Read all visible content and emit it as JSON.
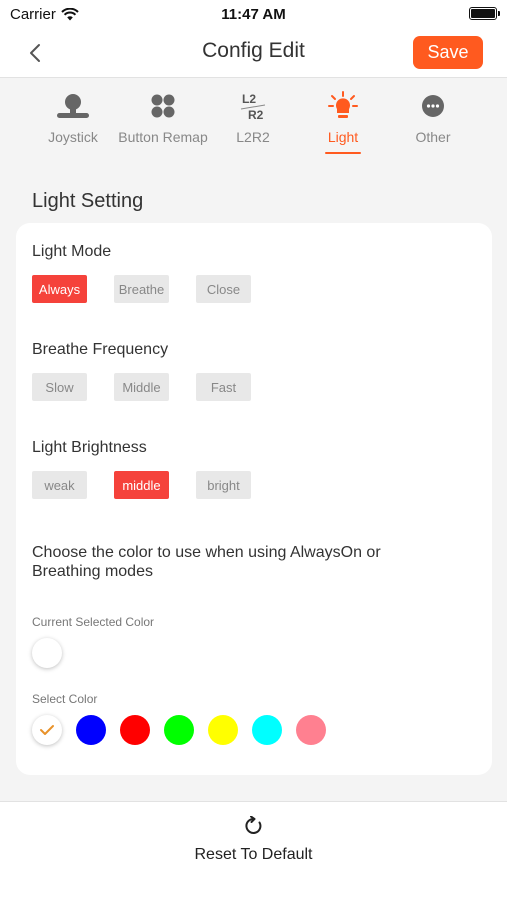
{
  "status_bar": {
    "carrier": "Carrier",
    "time": "11:47 AM",
    "wifi_icon": "wifi-icon",
    "battery_icon": "battery-icon"
  },
  "nav": {
    "title": "Config Edit",
    "save_label": "Save",
    "back_icon": "chevron-left-icon"
  },
  "tabs": [
    {
      "label": "Joystick",
      "icon": "joystick-icon",
      "active": false
    },
    {
      "label": "Button Remap",
      "icon": "button-remap-icon",
      "active": false
    },
    {
      "label": "L2R2",
      "icon": "l2r2-icon",
      "icon_text_top": "L2",
      "icon_text_bottom": "R2",
      "active": false
    },
    {
      "label": "Light",
      "icon": "light-bulb-icon",
      "active": true
    },
    {
      "label": "Other",
      "icon": "more-icon",
      "active": false
    }
  ],
  "light_setting": {
    "title": "Light Setting",
    "light_mode": {
      "title": "Light Mode",
      "options": [
        "Always",
        "Breathe",
        "Close"
      ],
      "selected": "Always"
    },
    "breathe_frequency": {
      "title": "Breathe Frequency",
      "options": [
        "Slow",
        "Middle",
        "Fast"
      ],
      "selected": null
    },
    "light_brightness": {
      "title": "Light Brightness",
      "options": [
        "weak",
        "middle",
        "bright"
      ],
      "selected": "middle"
    },
    "color_description": "Choose the color to use when using AlwaysOn or Breathing modes",
    "current_color_label": "Current Selected Color",
    "current_color": "#ffffff",
    "select_color_label": "Select Color",
    "swatches": [
      {
        "color": "#ffffff",
        "selected": true,
        "check_icon": "checkmark-icon"
      },
      {
        "color": "#0000ff",
        "selected": false
      },
      {
        "color": "#ff0000",
        "selected": false
      },
      {
        "color": "#00ff00",
        "selected": false
      },
      {
        "color": "#ffff00",
        "selected": false
      },
      {
        "color": "#00ffff",
        "selected": false
      },
      {
        "color": "#ff8090",
        "selected": false
      }
    ]
  },
  "bottom": {
    "reset_label": "Reset To Default",
    "reset_icon": "refresh-icon"
  },
  "colors": {
    "accent": "#ff5a1f",
    "selected_option": "#f5423b",
    "unselected_option": "#e8e8e8",
    "background": "#f4f4f4"
  }
}
